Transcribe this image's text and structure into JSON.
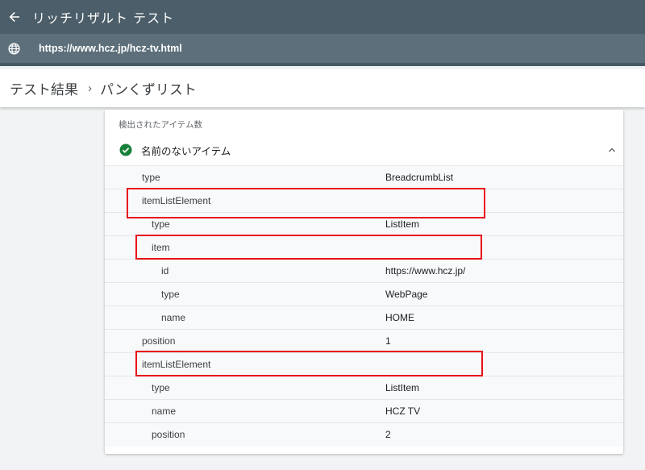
{
  "header": {
    "title": "リッチリザルト テスト",
    "back_icon": "arrow-left-icon"
  },
  "url_bar": {
    "url": "https://www.hcz.jp/hcz-tv.html",
    "icon": "globe-icon"
  },
  "breadcrumb": {
    "items": [
      "テスト結果",
      "パンくずリスト"
    ],
    "separator": "›"
  },
  "card": {
    "detected_label": "検出されたアイテム数",
    "item_title": "名前のないアイテム",
    "status_color": "#188038",
    "rows": [
      {
        "key": "type",
        "value": "BreadcrumbList"
      },
      {
        "key": "itemListElement",
        "value": ""
      },
      {
        "key": "type",
        "value": "ListItem"
      },
      {
        "key": "item",
        "value": ""
      },
      {
        "key": "id",
        "value": "https://www.hcz.jp/"
      },
      {
        "key": "type",
        "value": "WebPage"
      },
      {
        "key": "name",
        "value": "HOME"
      },
      {
        "key": "position",
        "value": "1"
      },
      {
        "key": "itemListElement",
        "value": ""
      },
      {
        "key": "type",
        "value": "ListItem"
      },
      {
        "key": "name",
        "value": "HCZ TV"
      },
      {
        "key": "position",
        "value": "2"
      }
    ]
  },
  "highlight_color": "#e8101a"
}
